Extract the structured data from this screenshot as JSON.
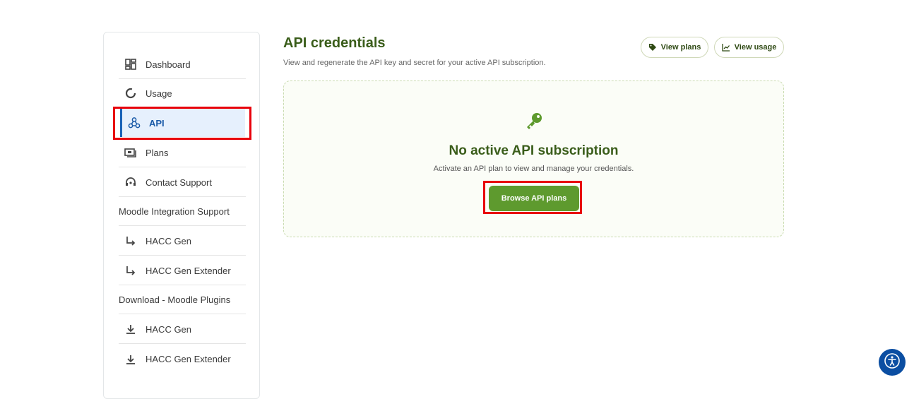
{
  "sidebar": {
    "items": [
      {
        "label": "Dashboard",
        "icon": "dashboard-icon"
      },
      {
        "label": "Usage",
        "icon": "usage-icon"
      },
      {
        "label": "API",
        "icon": "webhook-icon",
        "active": true
      },
      {
        "label": "Plans",
        "icon": "plans-icon"
      },
      {
        "label": "Contact Support",
        "icon": "support-icon"
      }
    ],
    "moodle_heading": "Moodle Integration Support",
    "moodle_items": [
      {
        "label": "HACC Gen",
        "icon": "subdirectory-arrow-icon"
      },
      {
        "label": "HACC Gen Extender",
        "icon": "subdirectory-arrow-icon"
      }
    ],
    "download_heading": "Download - Moodle Plugins",
    "download_items": [
      {
        "label": "HACC Gen",
        "icon": "download-icon"
      },
      {
        "label": "HACC Gen Extender",
        "icon": "download-icon"
      }
    ]
  },
  "header": {
    "title": "API credentials",
    "subtitle": "View and regenerate the API key and secret for your active API subscription.",
    "view_plans": "View plans",
    "view_usage": "View usage"
  },
  "empty_state": {
    "title": "No active API subscription",
    "text": "Activate an API plan to view and manage your credentials.",
    "button": "Browse API plans"
  },
  "colors": {
    "accent_green": "#5e9a2e",
    "title_green": "#3a5d1a",
    "active_blue": "#1a63b8",
    "highlight_red": "#e8000b",
    "a11y_blue": "#0b4ea2"
  }
}
